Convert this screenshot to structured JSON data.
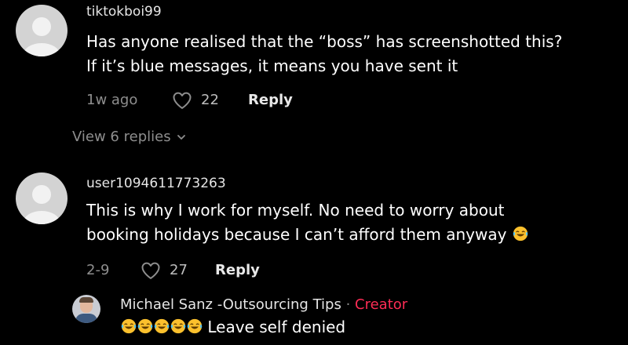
{
  "colors": {
    "background": "#000000",
    "username": "#e6e6e6",
    "meta": "#8e8e8e",
    "creator_badge": "#fe2c55"
  },
  "comments": [
    {
      "username": "tiktokboi99",
      "text_lines": [
        "Has anyone realised that the “boss” has screenshotted this?",
        "If it’s blue messages, it means you have sent it"
      ],
      "time": "1w ago",
      "likes": "22",
      "reply_label": "Reply",
      "view_replies": "View 6 replies"
    },
    {
      "username": "user1094611773263",
      "text_lines": [
        "This is why I work for myself. No need to worry about",
        "booking holidays because I can’t afford them anyway"
      ],
      "emoji": "face-with-tears-of-joy",
      "time": "2-9",
      "likes": "27",
      "reply_label": "Reply"
    }
  ],
  "creator_reply": {
    "username": "Michael Sanz -Outsourcing Tips",
    "separator": " · ",
    "badge": "Creator",
    "emoji_count": 5,
    "emoji": "face-with-tears-of-joy",
    "text": "Leave self denied"
  }
}
